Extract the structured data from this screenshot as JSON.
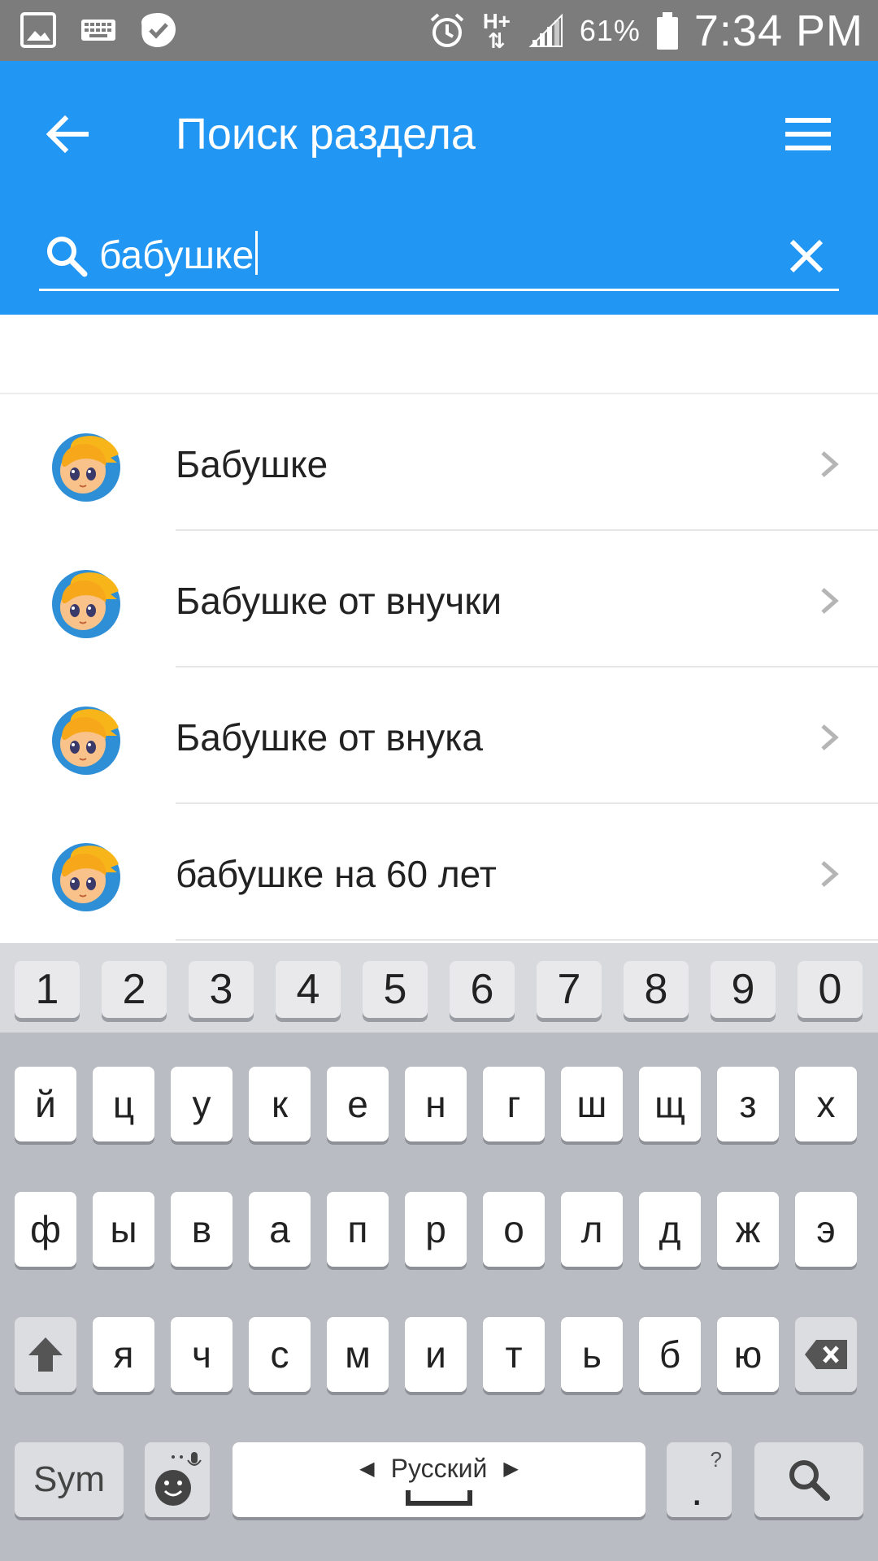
{
  "status_bar": {
    "battery_percent": "61%",
    "time": "7:34 PM",
    "network": "H+",
    "icons": [
      "image-icon",
      "keyboard-icon",
      "check-badge-icon",
      "alarm-icon",
      "network-hplus-icon",
      "signal-icon",
      "battery-icon"
    ]
  },
  "app_bar": {
    "title": "Поиск раздела",
    "back_icon": "arrow-back-icon",
    "menu_icon": "hamburger-menu-icon",
    "accent_color": "#2196f3"
  },
  "search": {
    "value": "бабушке",
    "clear_icon": "close-icon"
  },
  "results": [
    {
      "label": "Бабушке"
    },
    {
      "label": "Бабушке от внучки"
    },
    {
      "label": "Бабушке от внука"
    },
    {
      "label": "бабушке на 60 лет"
    }
  ],
  "keyboard": {
    "numbers": [
      "1",
      "2",
      "3",
      "4",
      "5",
      "6",
      "7",
      "8",
      "9",
      "0"
    ],
    "row1": [
      "й",
      "ц",
      "у",
      "к",
      "е",
      "н",
      "г",
      "ш",
      "щ",
      "з",
      "х"
    ],
    "row2": [
      "ф",
      "ы",
      "в",
      "а",
      "п",
      "р",
      "о",
      "л",
      "д",
      "ж",
      "э"
    ],
    "row3": [
      "я",
      "ч",
      "с",
      "м",
      "и",
      "т",
      "ь",
      "б",
      "ю"
    ],
    "sym_label": "Sym",
    "language_label": "Русский",
    "period_label": ".",
    "period_hint": "?"
  }
}
